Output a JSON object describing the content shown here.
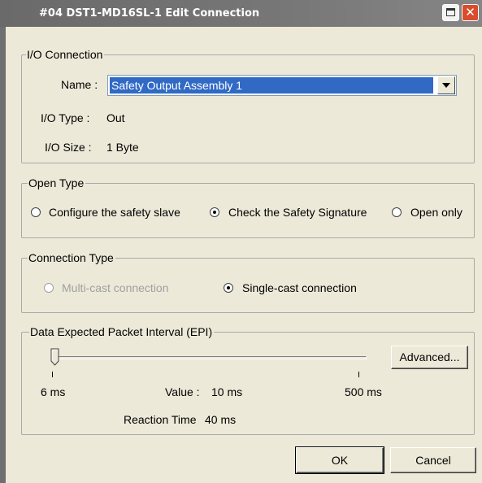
{
  "window": {
    "title": "#04 DST1-MD16SL-1 Edit Connection",
    "maximize_icon": "maximize-icon",
    "close_icon": "close-icon",
    "close_glyph": "✕"
  },
  "io_connection": {
    "legend": "I/O Connection",
    "name_label": "Name :",
    "name_value": "Safety Output Assembly 1",
    "type_label": "I/O Type :",
    "type_value": "Out",
    "size_label": "I/O Size :",
    "size_value": "1 Byte"
  },
  "open_type": {
    "legend": "Open Type",
    "options": [
      {
        "label": "Configure the safety slave",
        "selected": false
      },
      {
        "label": "Check the Safety Signature",
        "selected": true
      },
      {
        "label": "Open only",
        "selected": false
      }
    ]
  },
  "connection_type": {
    "legend": "Connection Type",
    "options": [
      {
        "label": "Multi-cast connection",
        "selected": false,
        "enabled": false
      },
      {
        "label": "Single-cast connection",
        "selected": true,
        "enabled": true
      }
    ]
  },
  "epi": {
    "legend": "Data Expected Packet Interval (EPI)",
    "advanced_label": "Advanced...",
    "min_label": "6 ms",
    "max_label": "500 ms",
    "value_label": "Value :",
    "value": "10 ms",
    "reaction_label": "Reaction Time",
    "reaction_value": "40 ms",
    "slider_value_ms": 10,
    "slider_min_ms": 6,
    "slider_max_ms": 500
  },
  "buttons": {
    "ok": "OK",
    "cancel": "Cancel"
  },
  "colors": {
    "selection": "#316ac5",
    "face": "#ece9d8",
    "titlebar": "#777777",
    "close": "#d94c2d"
  }
}
